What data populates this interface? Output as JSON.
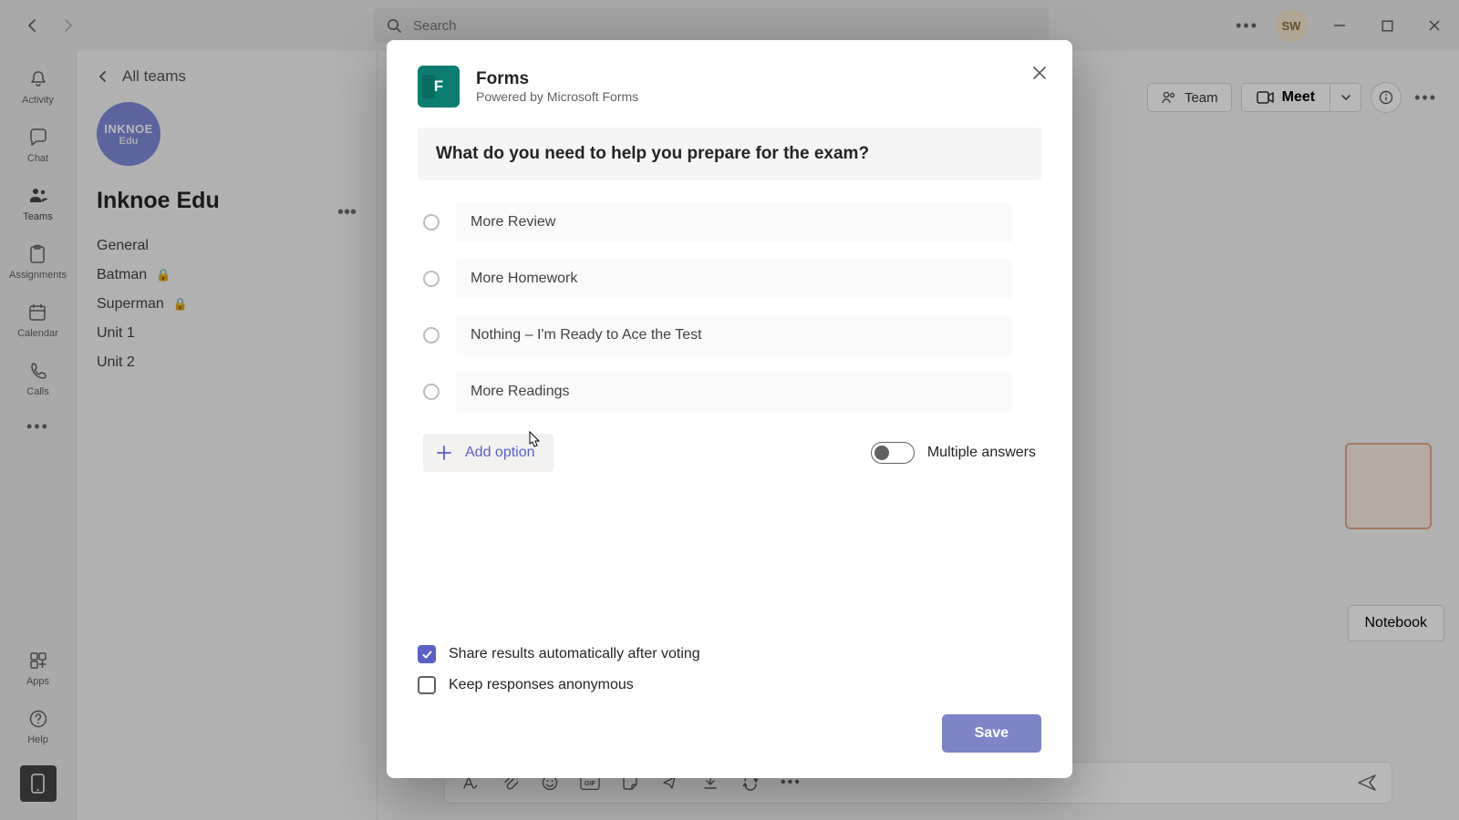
{
  "titlebar": {
    "search_placeholder": "Search",
    "user_initials": "SW"
  },
  "rail": {
    "items": [
      {
        "label": "Activity"
      },
      {
        "label": "Chat"
      },
      {
        "label": "Teams"
      },
      {
        "label": "Assignments"
      },
      {
        "label": "Calendar"
      },
      {
        "label": "Calls"
      }
    ],
    "apps_label": "Apps",
    "help_label": "Help"
  },
  "channels": {
    "back_label": "All teams",
    "team_avatar_line1": "INKNOE",
    "team_avatar_line2": "Edu",
    "team_name": "Inknoe Edu",
    "list": [
      {
        "name": "General",
        "locked": false
      },
      {
        "name": "Batman",
        "locked": true
      },
      {
        "name": "Superman",
        "locked": true
      },
      {
        "name": "Unit 1",
        "locked": false
      },
      {
        "name": "Unit 2",
        "locked": false
      }
    ]
  },
  "main": {
    "team_pill": "Team",
    "meet_label": "Meet",
    "notebook_label": "Notebook"
  },
  "dialog": {
    "title": "Forms",
    "subtitle": "Powered by Microsoft Forms",
    "question": "What do you need to help you prepare for the exam?",
    "options": [
      "More Review",
      "More Homework",
      "Nothing – I'm Ready to Ace the Test",
      "More Readings"
    ],
    "add_option_label": "Add option",
    "multiple_answers_label": "Multiple answers",
    "share_results_label": "Share results automatically after voting",
    "keep_anonymous_label": "Keep responses anonymous",
    "save_label": "Save",
    "forms_icon_letter": "F"
  }
}
